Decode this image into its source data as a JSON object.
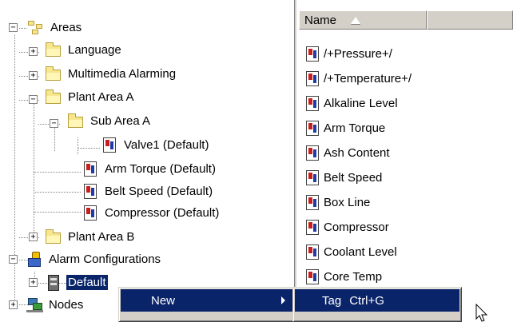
{
  "tree": {
    "items": [
      {
        "id": "areas",
        "label": "Areas",
        "icon": "areas-icon",
        "expander": "−"
      },
      {
        "id": "language",
        "label": "Language",
        "icon": "folder-icon",
        "expander": "+"
      },
      {
        "id": "multimedia-alarming",
        "label": "Multimedia Alarming",
        "icon": "folder-icon",
        "expander": "+"
      },
      {
        "id": "plant-area-a",
        "label": "Plant Area A",
        "icon": "folder-icon",
        "expander": "−"
      },
      {
        "id": "sub-area-a",
        "label": "Sub Area A",
        "icon": "folder-icon",
        "expander": "−"
      },
      {
        "id": "valve1",
        "label": "Valve1 (Default)",
        "icon": "tag-icon"
      },
      {
        "id": "arm-torque",
        "label": "Arm Torque (Default)",
        "icon": "tag-icon"
      },
      {
        "id": "belt-speed",
        "label": "Belt Speed (Default)",
        "icon": "tag-icon"
      },
      {
        "id": "compressor",
        "label": "Compressor (Default)",
        "icon": "tag-icon"
      },
      {
        "id": "plant-area-b",
        "label": "Plant Area B",
        "icon": "folder-icon",
        "expander": "+"
      },
      {
        "id": "alarm-configurations",
        "label": "Alarm Configurations",
        "icon": "alarm-config-icon",
        "expander": "−"
      },
      {
        "id": "default",
        "label": "Default",
        "icon": "default-config-icon",
        "expander": "+",
        "selected": true
      },
      {
        "id": "nodes",
        "label": "Nodes",
        "icon": "nodes-icon",
        "expander": "+"
      }
    ]
  },
  "list": {
    "header": {
      "name_label": "Name",
      "sort_icon": "sort-ascending-icon"
    },
    "items": [
      {
        "label": "/+Pressure+/",
        "icon": "tag-icon"
      },
      {
        "label": "/+Temperature+/",
        "icon": "tag-icon"
      },
      {
        "label": "Alkaline Level",
        "icon": "tag-icon"
      },
      {
        "label": "Arm Torque",
        "icon": "tag-icon"
      },
      {
        "label": "Ash Content",
        "icon": "tag-icon"
      },
      {
        "label": "Belt Speed",
        "icon": "tag-icon"
      },
      {
        "label": "Box Line",
        "icon": "tag-icon"
      },
      {
        "label": "Compressor",
        "icon": "tag-icon"
      },
      {
        "label": "Coolant Level",
        "icon": "tag-icon"
      },
      {
        "label": "Core Temp",
        "icon": "tag-icon"
      }
    ]
  },
  "context_menu": {
    "items": [
      {
        "label": "New",
        "has_submenu": true,
        "highlighted": true
      }
    ]
  },
  "submenu": {
    "items": [
      {
        "label": "Tag",
        "shortcut": "Ctrl+G",
        "highlighted": true
      }
    ]
  },
  "colors": {
    "selection": "#0a246a",
    "menu_face": "#d4d0c8",
    "folder": "#f6e68e"
  }
}
